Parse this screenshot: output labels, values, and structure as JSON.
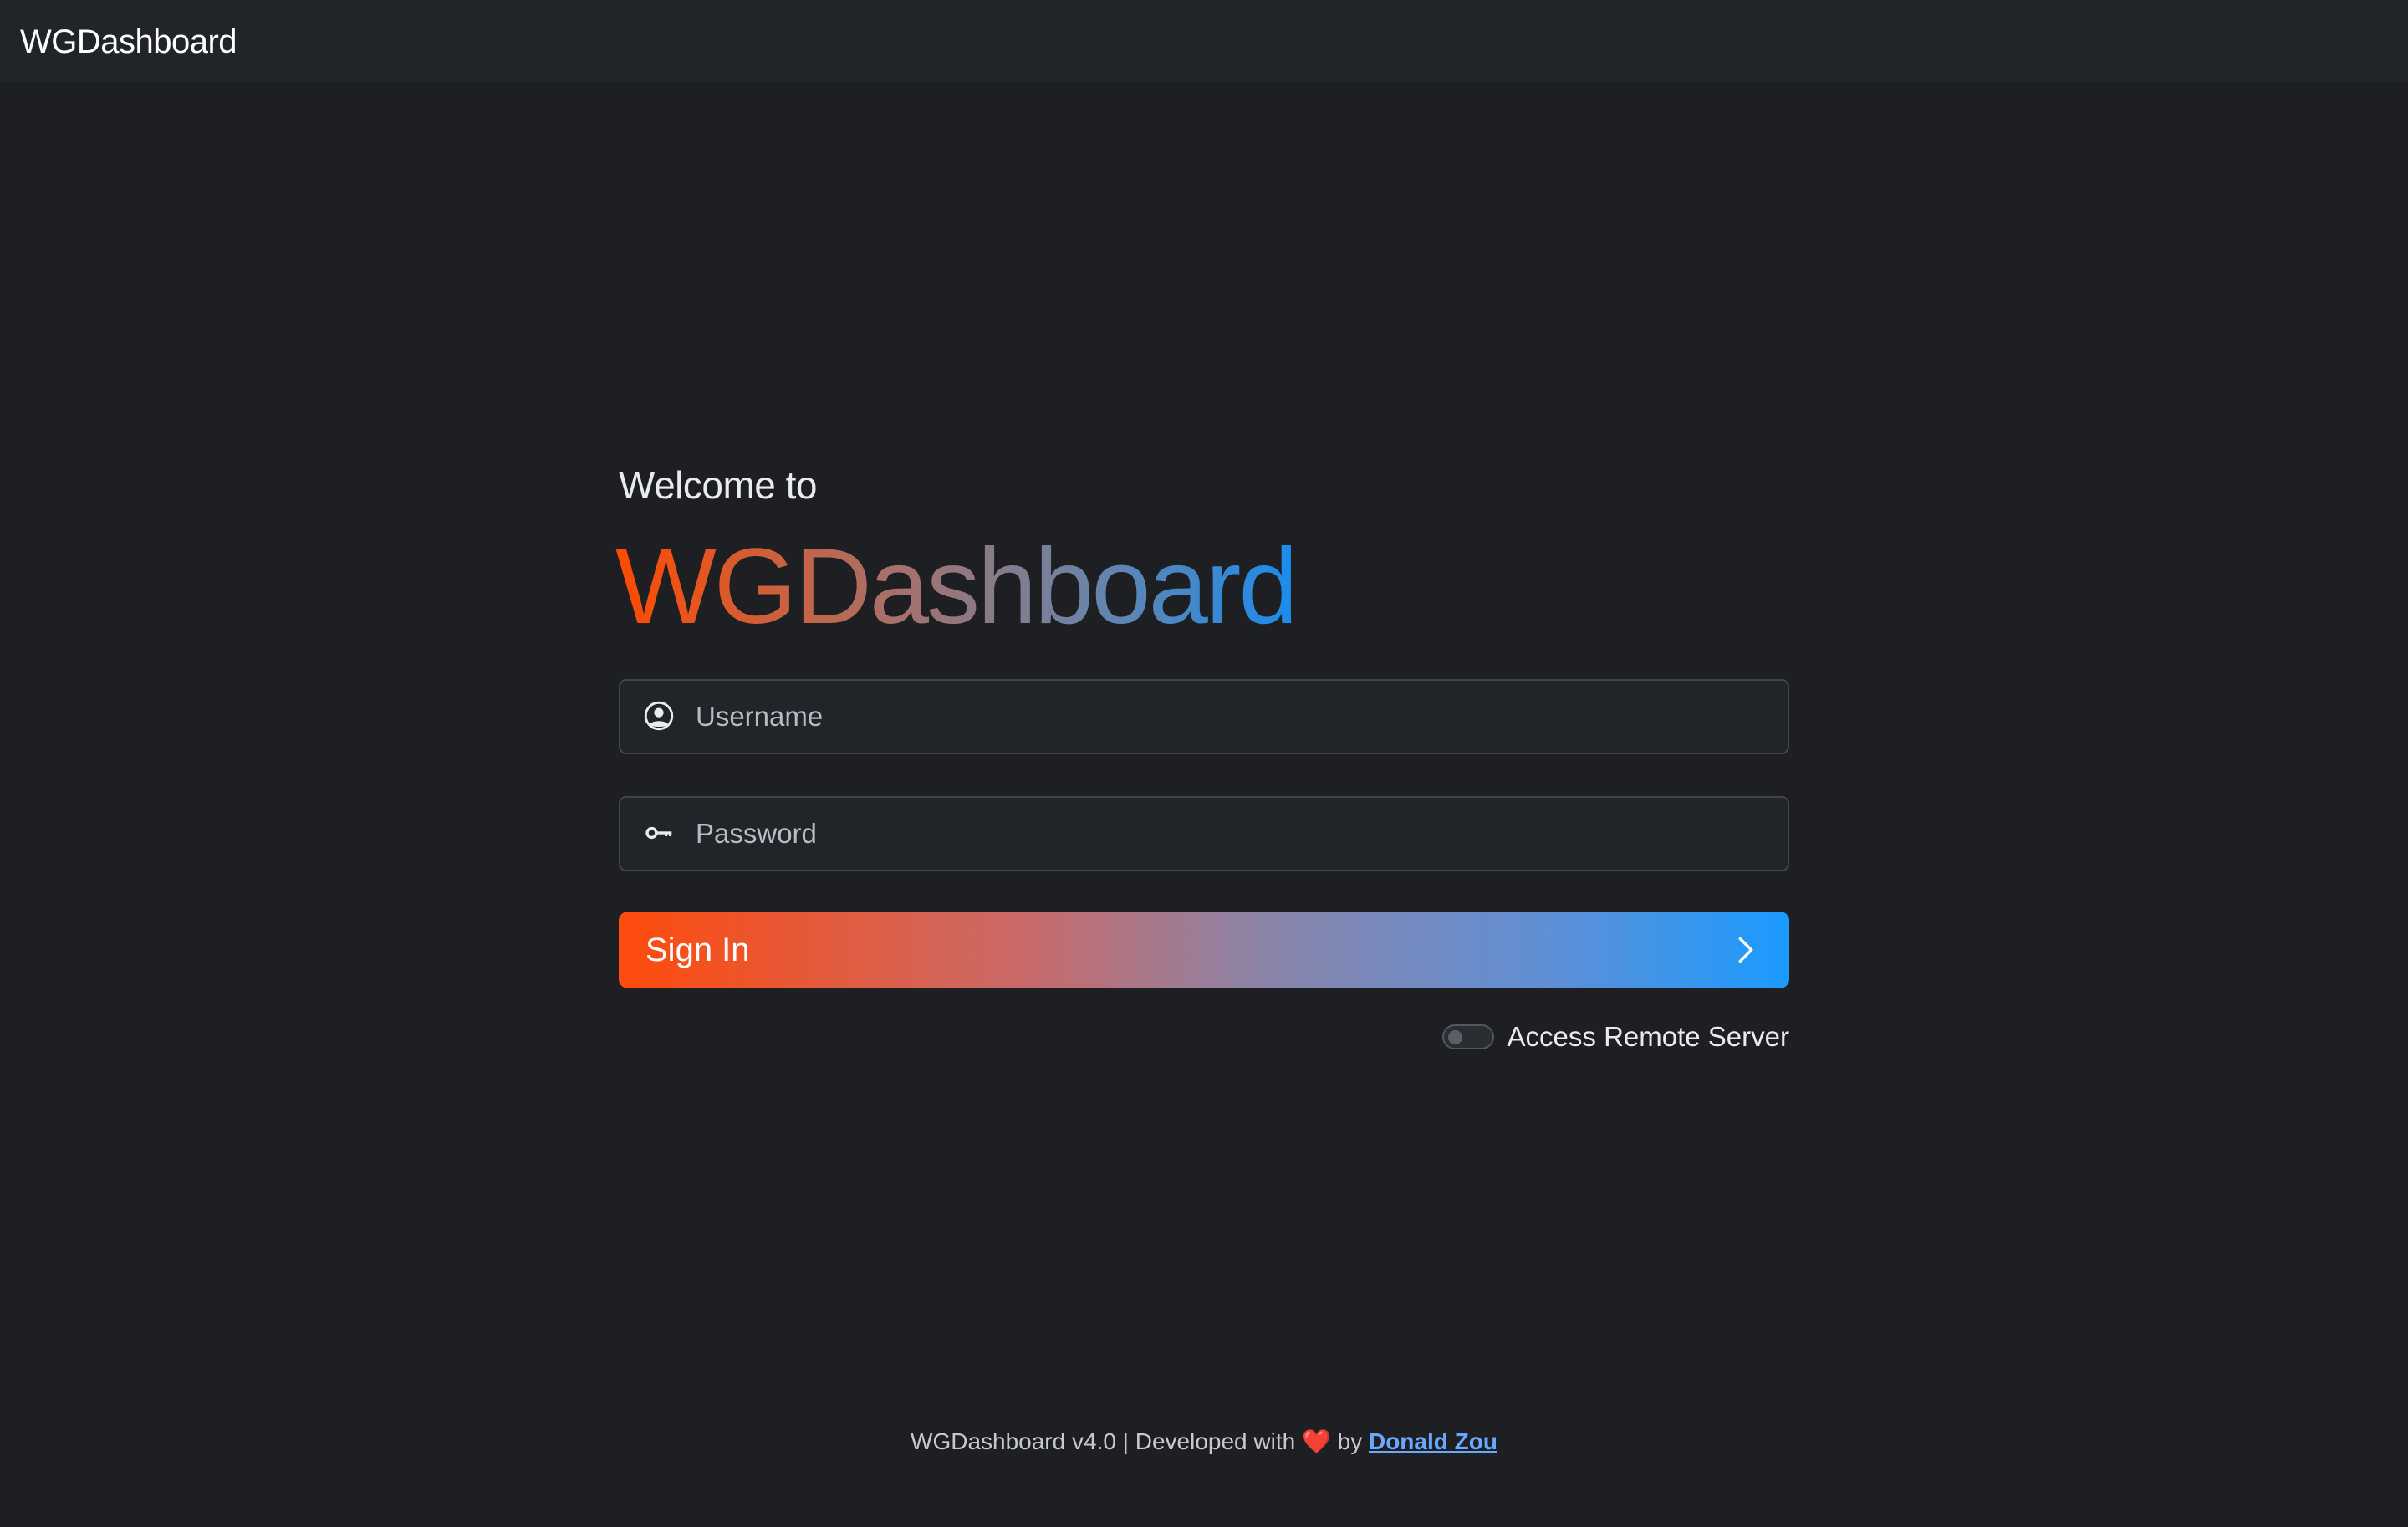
{
  "navbar": {
    "brand": "WGDashboard"
  },
  "login": {
    "welcome": "Welcome to",
    "title": "WGDashboard",
    "username_placeholder": "Username",
    "password_placeholder": "Password",
    "signin_label": "Sign In",
    "remote_label": "Access Remote Server",
    "remote_enabled": false
  },
  "footer": {
    "prefix": "WGDashboard v4.0 | Developed with",
    "heart": "❤️",
    "by": "by",
    "author": "Donald Zou"
  },
  "icons": {
    "user": "person-circle-icon",
    "password": "key-icon",
    "signin": "chevron-right-icon"
  },
  "colors": {
    "background": "#1e1f22",
    "gradient_start": "#ff4b0d",
    "gradient_end": "#1a9bff",
    "link": "#6aa7ff"
  }
}
